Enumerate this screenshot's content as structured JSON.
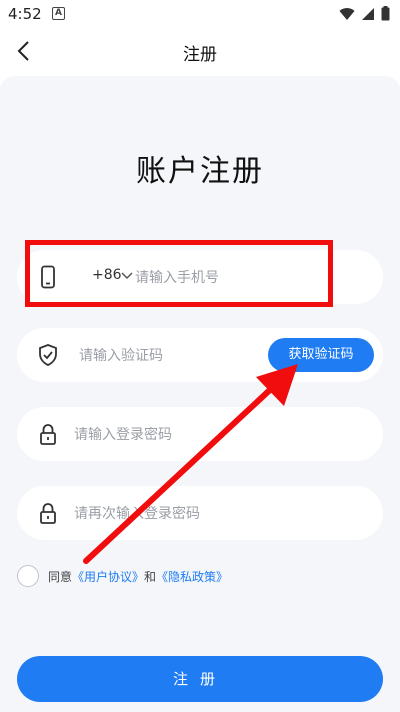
{
  "status_bar": {
    "time": "4:52",
    "notification_glyph": "A",
    "icons": [
      "wifi-icon",
      "signal-icon",
      "battery-icon"
    ]
  },
  "nav": {
    "title": "注册",
    "back_icon": "back-arrow-icon"
  },
  "heading": "账户注册",
  "phone_field": {
    "country_code": "+86",
    "placeholder": "请输入手机号",
    "icon": "phone-icon"
  },
  "code_field": {
    "placeholder": "请输入验证码",
    "icon": "shield-check-icon",
    "button_label": "获取验证码"
  },
  "password_field": {
    "placeholder": "请输入登录密码",
    "icon": "lock-icon"
  },
  "confirm_password_field": {
    "placeholder": "请再次输入登录密码",
    "icon": "lock-icon"
  },
  "agreement": {
    "prefix": "同意",
    "user_agreement": "《用户协议》",
    "conjunction": "和",
    "privacy_policy": "《隐私政策》"
  },
  "register_button": "注册",
  "colors": {
    "accent": "#1f7cf2",
    "panel_background": "#f4f6f9",
    "annotation_red": "#f10d0d"
  }
}
